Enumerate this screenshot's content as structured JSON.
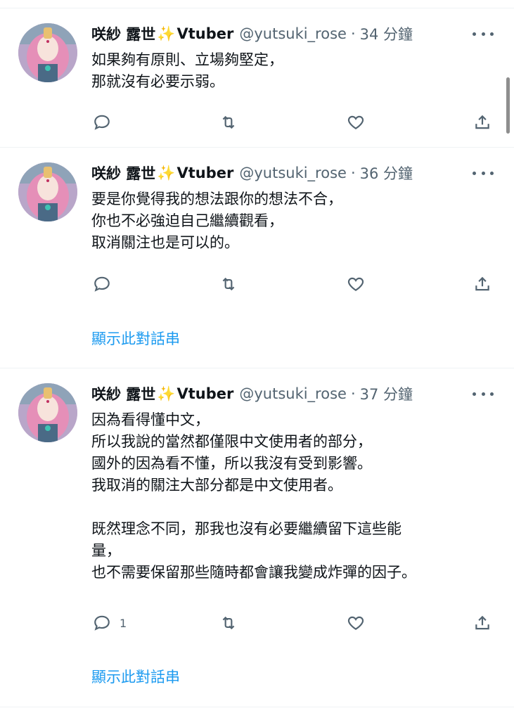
{
  "author": {
    "name": "咲紗 露世",
    "sparkle": "✨",
    "badge_text": "Vtuber",
    "handle": "@yutsuki_rose"
  },
  "separator": "·",
  "show_thread_label": "顯示此對話串",
  "colors": {
    "link": "#1d9bf0",
    "secondary_text": "#536471",
    "primary_text": "#0f1419"
  },
  "tweets": [
    {
      "time": "34 分鐘",
      "text": "如果夠有原則、立場夠堅定，\n那就沒有必要示弱。",
      "reply_count": ""
    },
    {
      "time": "36 分鐘",
      "text": "要是你覺得我的想法跟你的想法不合，\n你也不必強迫自己繼續觀看，\n取消關注也是可以的。",
      "reply_count": ""
    },
    {
      "time": "37 分鐘",
      "text": "因為看得懂中文，\n所以我說的當然都僅限中文使用者的部分，\n國外的因為看不懂，所以我沒有受到影響。\n我取消的關注大部分都是中文使用者。\n\n既然理念不同，那我也沒有必要繼續留下這些能\n量，\n也不需要保留那些隨時都會讓我變成炸彈的因子。",
      "reply_count": "1"
    }
  ]
}
